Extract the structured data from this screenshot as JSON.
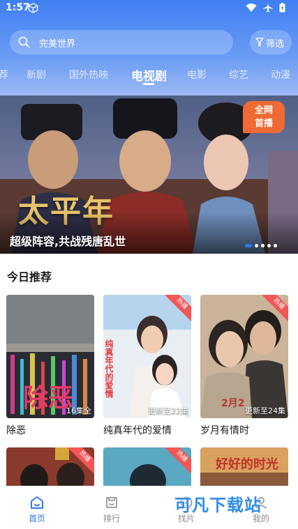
{
  "status_bar": {
    "time": "1:57"
  },
  "search": {
    "text": "完美世界"
  },
  "filter": {
    "label": "筛选"
  },
  "tabs": [
    {
      "label": "荐"
    },
    {
      "label": "新剧"
    },
    {
      "label": "国外热映"
    },
    {
      "label": "电视剧"
    },
    {
      "label": "电影"
    },
    {
      "label": "综艺"
    },
    {
      "label": "动漫"
    }
  ],
  "active_tab": "电视剧",
  "banner": {
    "caption": "超级阵容,共战残唐乱世",
    "title_art": "太平年",
    "badge": [
      "全网",
      "首播"
    ],
    "page_count": 5,
    "active_index": 0
  },
  "section": {
    "title": "今日推荐"
  },
  "cards": [
    {
      "name": "除恶",
      "episode": "16集全",
      "hot": "",
      "poster_text": "除恶"
    },
    {
      "name": "纯真年代的爱情",
      "episode": "更新至22集",
      "hot": "热播",
      "poster_text": "纯真年代的爱情"
    },
    {
      "name": "岁月有情时",
      "episode": "更新至24集",
      "hot": "热播",
      "poster_text": "2月2"
    }
  ],
  "cards_row2": [
    {
      "hot": "热播"
    },
    {
      "hot": "热播"
    },
    {
      "hot": "",
      "poster_text": "好好的时光"
    }
  ],
  "bottom_nav": [
    {
      "label": "首页",
      "icon": "home-icon"
    },
    {
      "label": "排行",
      "icon": "ranking-icon"
    },
    {
      "label": "找片",
      "icon": "discover-icon"
    },
    {
      "label": "我的",
      "icon": "profile-icon"
    }
  ],
  "active_nav": "首页",
  "watermark": "可凡下载站",
  "colors": {
    "accent": "#2f78ee",
    "header": "#3f7ff3",
    "hot": "#f25656"
  }
}
